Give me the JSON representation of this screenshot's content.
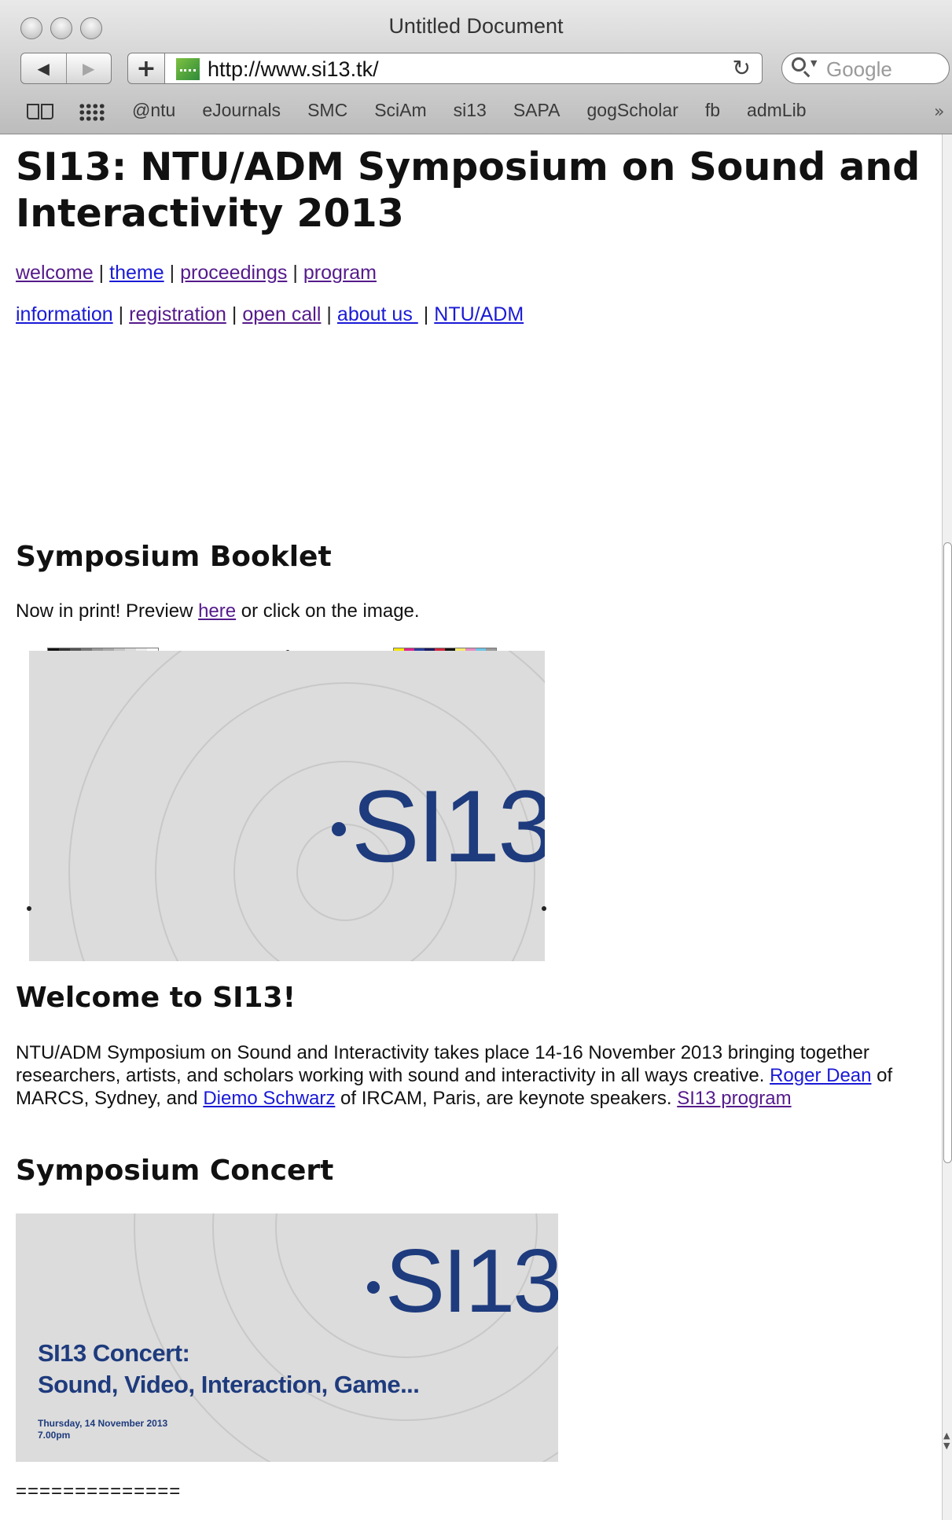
{
  "window": {
    "title": "Untitled Document"
  },
  "toolbar": {
    "back_icon": "◀",
    "forward_icon": "▶",
    "add_icon": "+",
    "url": "http://www.si13.tk/",
    "reload_icon": "↻",
    "search_placeholder": "Google"
  },
  "bookmarks": {
    "items": [
      "@ntu",
      "eJournals",
      "SMC",
      "SciAm",
      "si13",
      "SAPA",
      "gogScholar",
      "fb",
      "admLib"
    ],
    "more_icon": "»"
  },
  "page": {
    "title": "SI13: NTU/ADM Symposium on Sound and Interactivity 2013",
    "nav_row1": [
      "welcome",
      "theme",
      "proceedings",
      "program"
    ],
    "nav_row2": [
      "information",
      "registration",
      "open call",
      "about us ",
      "NTU/ADM"
    ],
    "booklet": {
      "heading": "Symposium Booklet",
      "text_before": "Now in print! Preview ",
      "link": "here",
      "text_after": " or click on the image.",
      "logo": "SI13"
    },
    "welcome": {
      "heading": "Welcome to SI13!",
      "text1": "NTU/ADM Symposium on Sound and Interactivity takes place 14-16 November 2013 bringing together researchers, artists, and scholars working with sound and interactivity in all ways creative. ",
      "link1": "Roger Dean",
      "text2": " of MARCS, Sydney, and ",
      "link2": "Diemo Schwarz",
      "text3": " of IRCAM, Paris, are keynote speakers. ",
      "link3": "SI13 program"
    },
    "concert": {
      "heading": "Symposium Concert",
      "logo": "SI13",
      "title_line1": "SI13 Concert:",
      "title_line2": "Sound, Video, Interaction, Game...",
      "date_line1": "Thursday, 14 November 2013",
      "date_line2": "7.00pm"
    },
    "divider": "=============="
  },
  "colors": {
    "link": "#1a1ad6",
    "visited": "#551a8b",
    "logo_blue": "#1e3b7d"
  }
}
